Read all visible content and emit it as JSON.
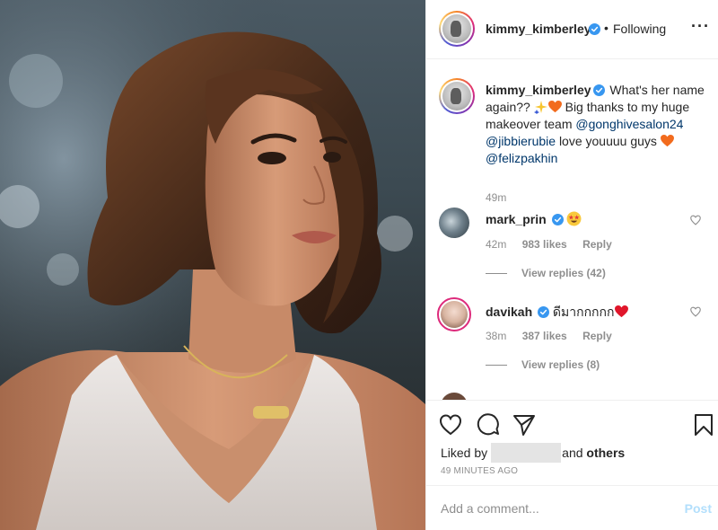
{
  "post": {
    "username": "kimmy_kimberley",
    "follow_status": "Following",
    "more_icon": "more-horizontal-icon"
  },
  "caption": {
    "username": "kimmy_kimberley",
    "text_1": "What's her name again??",
    "text_2": "Big thanks to my huge makeover team",
    "mention_1": "@gonghivesalon24",
    "mention_2": "@jibbierubie",
    "text_3": "love youuuu guys",
    "mention_3": "@felizpakhin",
    "time": "49m"
  },
  "comments": [
    {
      "username": "mark_prin",
      "text": "",
      "time": "42m",
      "likes": "983 likes",
      "reply": "Reply",
      "view_replies": "View replies (42)"
    },
    {
      "username": "davikah",
      "text": "ดีมากกกกก",
      "time": "38m",
      "likes": "387 likes",
      "reply": "Reply",
      "view_replies": "View replies (8)"
    }
  ],
  "actions": {
    "liked_by": "Liked by",
    "and": "and",
    "others": "others",
    "timestamp": "49 MINUTES AGO"
  },
  "comment_box": {
    "placeholder": "Add a comment...",
    "post_label": "Post"
  },
  "colors": {
    "verified": "#3897f0",
    "link": "#00376b",
    "post_disabled": "#b2dffc",
    "heart_emoji": "#f26b1d"
  }
}
